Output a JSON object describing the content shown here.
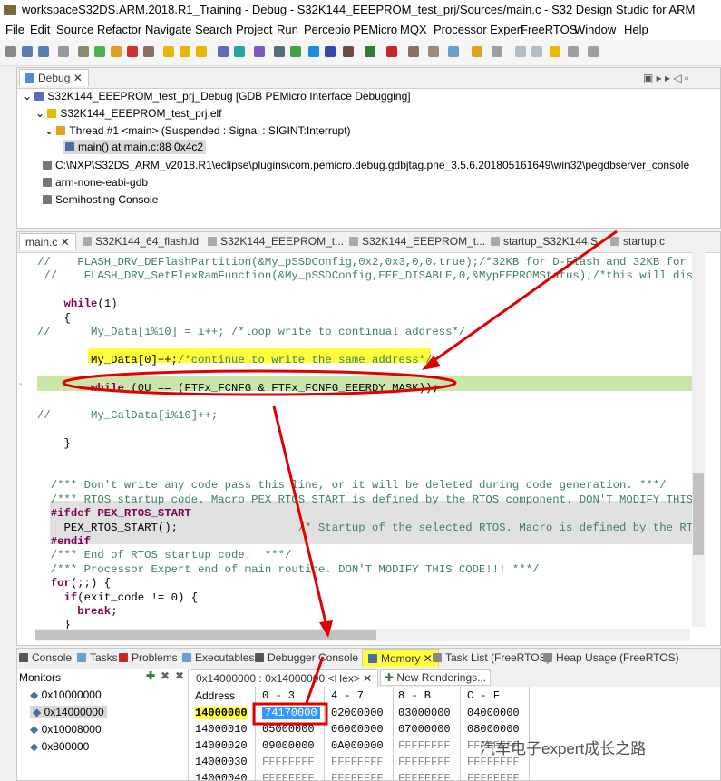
{
  "window": {
    "title": "workspaceS32DS.ARM.2018.R1_Training - Debug - S32K144_EEEPROM_test_prj/Sources/main.c - S32 Design Studio for ARM"
  },
  "menu": [
    "File",
    "Edit",
    "Source",
    "Refactor",
    "Navigate",
    "Search",
    "Project",
    "Run",
    "Percepio",
    "PEMicro",
    "MQX",
    "Processor Expert",
    "FreeRTOS",
    "Window",
    "Help"
  ],
  "debug_view": {
    "tab": "Debug",
    "items": [
      "S32K144_EEEPROM_test_prj_Debug [GDB PEMicro Interface Debugging]",
      "S32K144_EEEPROM_test_prj.elf",
      "Thread #1 <main> (Suspended : Signal : SIGINT:Interrupt)",
      "main() at main.c:88 0x4c2",
      "C:\\NXP\\S32DS_ARM_v2018.R1\\eclipse\\plugins\\com.pemicro.debug.gdbjtag.pne_3.5.6.201805161649\\win32\\pegdbserver_console",
      "arm-none-eabi-gdb",
      "Semihosting Console"
    ]
  },
  "editor": {
    "tabs": [
      "main.c",
      "S32K144_64_flash.ld",
      "S32K144_EEEPROM_t...",
      "S32K144_EEEPROM_t...",
      "startup_S32K144.S",
      "startup.c"
    ],
    "lines": [
      {
        "t": "//    FLASH_DRV_DEFlashPartition(&My_pSSDConfig,0x2,0x3,0,0,true);/*32KB for D-Flash and 32KB for",
        "c": "cmt"
      },
      {
        "t": " //    FLASH_DRV_SetFlexRamFunction(&My_pSSDConfig,EEE_DISABLE,0,&MypEEPROMStatus);/*this will disa",
        "c": "cmt"
      },
      {
        "t": "",
        "c": ""
      },
      {
        "t": "    while(1)",
        "c": "kw"
      },
      {
        "t": "    {",
        "c": ""
      },
      {
        "t": "//      My_Data[i%10] = i++; /*loop write to continual address*/",
        "c": "cmt"
      },
      {
        "t": "",
        "c": ""
      },
      {
        "t": "        My_Data[0]++;/*continue to write the same address*/",
        "c": "mix"
      },
      {
        "t": "",
        "c": ""
      },
      {
        "t": "        while (0U == (FTFx_FCNFG & FTFx_FCNFG_EEERDY_MASK));",
        "c": "kw2"
      },
      {
        "t": "",
        "c": ""
      },
      {
        "t": "//      My_CalData[i%10]++;",
        "c": "cmt"
      },
      {
        "t": "",
        "c": ""
      },
      {
        "t": "    }",
        "c": ""
      },
      {
        "t": "",
        "c": ""
      },
      {
        "t": "",
        "c": ""
      },
      {
        "t": "  /*** Don't write any code pass this line, or it will be deleted during code generation. ***/",
        "c": "cmt"
      },
      {
        "t": "  /*** RTOS startup code. Macro PEX_RTOS_START is defined by the RTOS component. DON'T MODIFY THIS",
        "c": "cmt"
      },
      {
        "t": "  #ifdef PEX_RTOS_START",
        "c": "pre"
      },
      {
        "t": "    PEX_RTOS_START();                  /* Startup of the selected RTOS. Macro is defined by the RT",
        "c": "mix2"
      },
      {
        "t": "  #endif",
        "c": "pre"
      },
      {
        "t": "  /*** End of RTOS startup code.  ***/",
        "c": "cmt"
      },
      {
        "t": "  /*** Processor Expert end of main routine. DON'T MODIFY THIS CODE!!! ***/",
        "c": "cmt"
      },
      {
        "t": "  for(;;) {",
        "c": "kw"
      },
      {
        "t": "    if(exit_code != 0) {",
        "c": "kw"
      },
      {
        "t": "      break;",
        "c": "kw"
      },
      {
        "t": "    }",
        "c": ""
      }
    ]
  },
  "bottom_tabs": [
    "Console",
    "Tasks",
    "Problems",
    "Executables",
    "Debugger Console",
    "Memory",
    "Task List (FreeRTOS)",
    "Heap Usage (FreeRTOS)"
  ],
  "monitors": {
    "title": "Monitors",
    "items": [
      "0x10000000",
      "0x14000000",
      "0x10008000",
      "0x800000"
    ]
  },
  "memory": {
    "rendering_tab": "0x14000000 : 0x14000000 <Hex>",
    "new_renderings": "New Renderings...",
    "headers": [
      "Address",
      "0 - 3",
      "4 - 7",
      "8 - B",
      "C - F"
    ],
    "rows": [
      [
        "14000000",
        "74170000",
        "02000000",
        "03000000",
        "04000000"
      ],
      [
        "14000010",
        "05000000",
        "06000000",
        "07000000",
        "08000000"
      ],
      [
        "14000020",
        "09000000",
        "0A000000",
        "FFFFFFFF",
        "FFFFFFFF"
      ],
      [
        "14000030",
        "FFFFFFFF",
        "FFFFFFFF",
        "FFFFFFFF",
        "FFFFFFFF"
      ],
      [
        "14000040",
        "FFFFFFFF",
        "FFFFFFFF",
        "FFFFFFFF",
        "FFFFFFFF"
      ]
    ]
  },
  "watermark": "汽车电子expert成长之路",
  "colors": {
    "highlight": "#ffff3a",
    "red": "#e00000",
    "selected": "#3399ff"
  }
}
